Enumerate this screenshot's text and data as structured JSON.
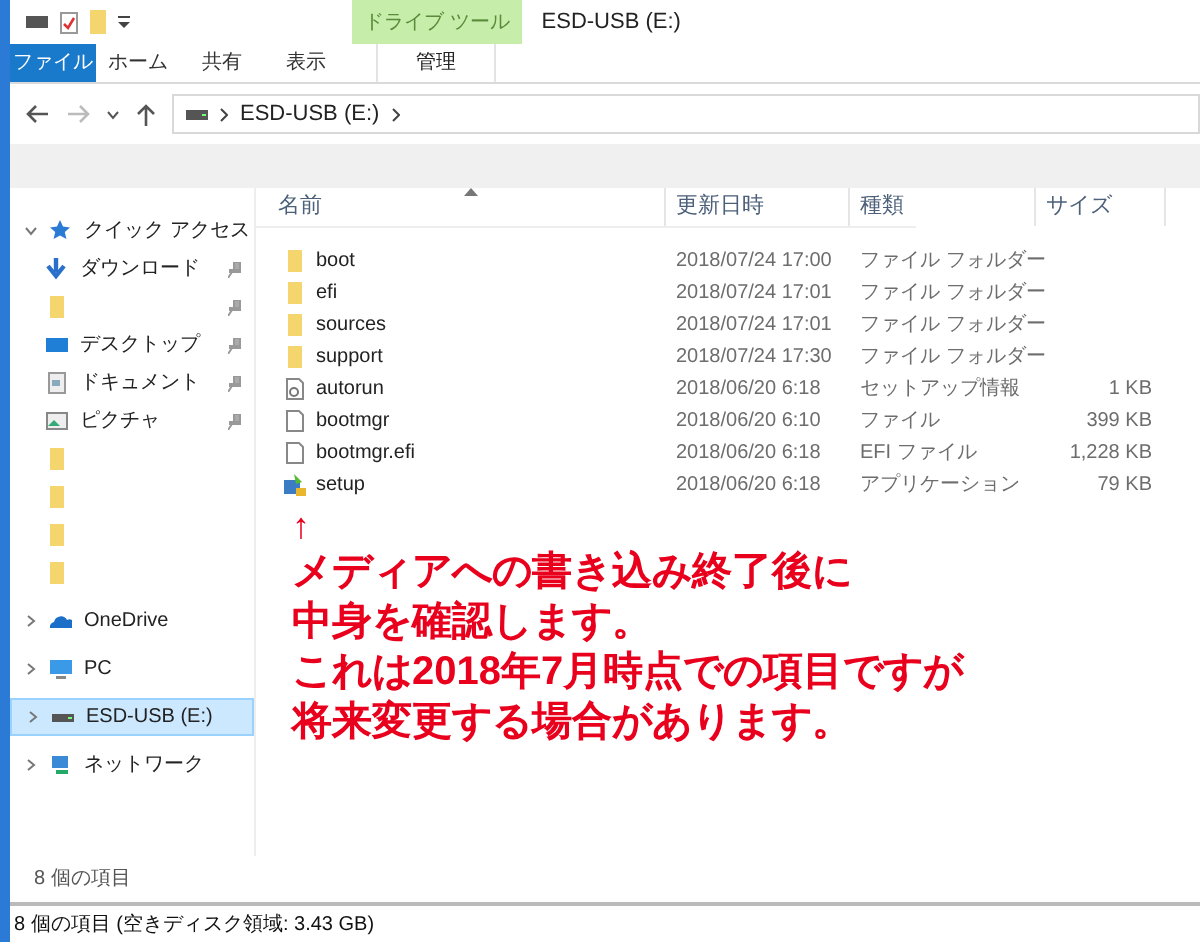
{
  "title_bar": {
    "contextual_tab": "ドライブ ツール",
    "title": "ESD-USB (E:)"
  },
  "ribbon_tabs": [
    {
      "label": "ファイル",
      "kind": "file"
    },
    {
      "label": "ホーム",
      "kind": "tab"
    },
    {
      "label": "共有",
      "kind": "tab"
    },
    {
      "label": "表示",
      "kind": "tab"
    },
    {
      "label": "管理",
      "kind": "context"
    }
  ],
  "address_bar": {
    "path": "ESD-USB (E:)"
  },
  "sidebar": {
    "items": [
      {
        "label": "クイック アクセス",
        "kind": "quick",
        "expanded": true,
        "selected": false,
        "children": [
          {
            "label": "ダウンロード",
            "kind": "download",
            "pinned": true
          },
          {
            "kind": "folder",
            "pinned": true
          },
          {
            "label": "デスクトップ",
            "kind": "desktop",
            "pinned": true
          },
          {
            "label": "ドキュメント",
            "kind": "document",
            "pinned": true
          },
          {
            "label": "ピクチャ",
            "kind": "picture",
            "pinned": true
          },
          {
            "kind": "folder",
            "pinned": false
          },
          {
            "kind": "folder",
            "pinned": false
          },
          {
            "kind": "folder",
            "pinned": false
          },
          {
            "kind": "folder",
            "pinned": false
          }
        ]
      },
      {
        "label": "OneDrive",
        "kind": "onedrive",
        "expanded": false,
        "selected": false
      },
      {
        "label": "PC",
        "kind": "pc",
        "expanded": false,
        "selected": false
      },
      {
        "label": "ESD-USB (E:)",
        "kind": "usb",
        "expanded": false,
        "selected": true
      },
      {
        "label": "ネットワーク",
        "kind": "network",
        "expanded": false,
        "selected": false
      }
    ]
  },
  "table": {
    "columns": [
      "名前",
      "更新日時",
      "種類",
      "サイズ"
    ],
    "rows": [
      {
        "kind": "folder",
        "name": "boot",
        "date": "2018/07/24 17:00",
        "type": "ファイル フォルダー"
      },
      {
        "kind": "folder",
        "name": "efi",
        "date": "2018/07/24 17:01",
        "type": "ファイル フォルダー"
      },
      {
        "kind": "folder",
        "name": "sources",
        "date": "2018/07/24 17:01",
        "type": "ファイル フォルダー"
      },
      {
        "kind": "folder",
        "name": "support",
        "date": "2018/07/24 17:30",
        "type": "ファイル フォルダー"
      },
      {
        "kind": "settings",
        "name": "autorun",
        "date": "2018/06/20 6:18",
        "type": "セットアップ情報",
        "size": "1 KB"
      },
      {
        "kind": "file",
        "name": "bootmgr",
        "date": "2018/06/20 6:10",
        "type": "ファイル",
        "size": "399 KB"
      },
      {
        "kind": "file",
        "name": "bootmgr.efi",
        "date": "2018/06/20 6:18",
        "type": "EFI ファイル",
        "size": "1,228 KB"
      },
      {
        "kind": "app",
        "name": "setup",
        "date": "2018/06/20 6:18",
        "type": "アプリケーション",
        "size": "79 KB"
      }
    ]
  },
  "annotation": {
    "arrow": "↑",
    "lines": [
      "メディアへの書き込み終了後に",
      "中身を確認します。",
      "これは2018年7月時点での項目ですが",
      "将来変更する場合があります。"
    ]
  },
  "item_count": "8 個の項目",
  "status_bar": "8 個の項目 (空きディスク領域: 3.43 GB)"
}
